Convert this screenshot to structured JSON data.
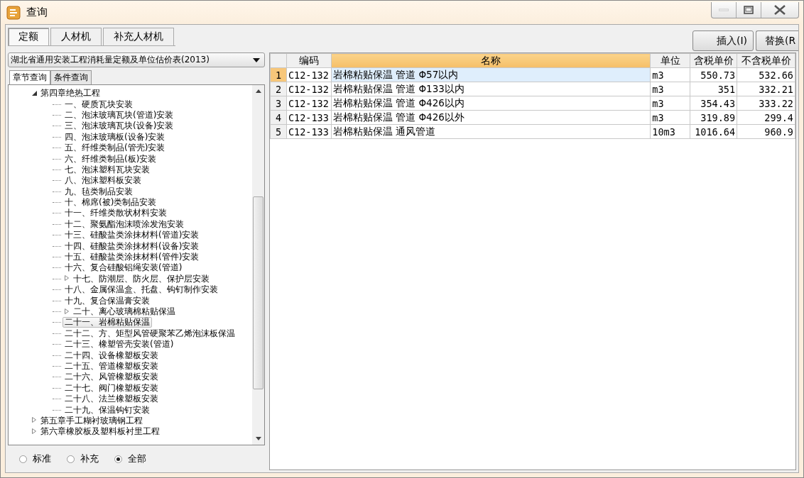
{
  "window": {
    "title": "查询"
  },
  "tabs": [
    {
      "label": "定额",
      "selected": true
    },
    {
      "label": "人材机",
      "selected": false
    },
    {
      "label": "补充人材机",
      "selected": false
    }
  ],
  "actions": [
    "插入(I)",
    "替换(R"
  ],
  "library": {
    "value": "湖北省通用安装工程消耗量定额及单位估价表(2013)"
  },
  "query_tabs": [
    {
      "label": "章节查询",
      "selected": true
    },
    {
      "label": "条件查询",
      "selected": false
    }
  ],
  "tree": [
    {
      "label": "第四章绝热工程",
      "kind": "folder",
      "expanded": true,
      "selected": false,
      "children": [
        {
          "label": "一、硬质瓦块安装",
          "kind": "leaf",
          "selected": false
        },
        {
          "label": "二、泡沫玻璃瓦块(管道)安装",
          "kind": "leaf",
          "selected": false
        },
        {
          "label": "三、泡沫玻璃瓦块(设备)安装",
          "kind": "leaf",
          "selected": false
        },
        {
          "label": "四、泡沫玻璃板(设备)安装",
          "kind": "leaf",
          "selected": false
        },
        {
          "label": "五、纤维类制品(管壳)安装",
          "kind": "leaf",
          "selected": false
        },
        {
          "label": "六、纤维类制品(板)安装",
          "kind": "leaf",
          "selected": false
        },
        {
          "label": "七、泡沫塑料瓦块安装",
          "kind": "leaf",
          "selected": false
        },
        {
          "label": "八、泡沫塑料板安装",
          "kind": "leaf",
          "selected": false
        },
        {
          "label": "九、毡类制品安装",
          "kind": "leaf",
          "selected": false
        },
        {
          "label": "十、棉席(被)类制品安装",
          "kind": "leaf",
          "selected": false
        },
        {
          "label": "十一、纤维类散状材料安装",
          "kind": "leaf",
          "selected": false
        },
        {
          "label": "十二、聚氨酯泡沫喷涂发泡安装",
          "kind": "leaf",
          "selected": false
        },
        {
          "label": "十三、硅酸盐类涂抹材料(管道)安装",
          "kind": "leaf",
          "selected": false
        },
        {
          "label": "十四、硅酸盐类涂抹材料(设备)安装",
          "kind": "leaf",
          "selected": false
        },
        {
          "label": "十五、硅酸盐类涂抹材料(管件)安装",
          "kind": "leaf",
          "selected": false
        },
        {
          "label": "十六、复合硅酸铝绳安装(管道)",
          "kind": "leaf",
          "selected": false
        },
        {
          "label": "十七、防潮层、防火层、保护层安装",
          "kind": "folder",
          "expanded": false,
          "selected": false
        },
        {
          "label": "十八、金属保温盒、托盘、钩钉制作安装",
          "kind": "leaf",
          "selected": false
        },
        {
          "label": "十九、复合保温膏安装",
          "kind": "leaf",
          "selected": false
        },
        {
          "label": "二十、离心玻璃棉粘贴保温",
          "kind": "folder",
          "expanded": false,
          "selected": false
        },
        {
          "label": "二十一、岩棉粘贴保温",
          "kind": "leaf",
          "selected": true
        },
        {
          "label": "二十二、方、矩型风管硬聚苯乙烯泡沫板保温",
          "kind": "leaf",
          "selected": false
        },
        {
          "label": "二十三、橡塑管壳安装(管道)",
          "kind": "leaf",
          "selected": false
        },
        {
          "label": "二十四、设备橡塑板安装",
          "kind": "leaf",
          "selected": false
        },
        {
          "label": "二十五、管道橡塑板安装",
          "kind": "leaf",
          "selected": false
        },
        {
          "label": "二十六、风管橡塑板安装",
          "kind": "leaf",
          "selected": false
        },
        {
          "label": "二十七、阀门橡塑板安装",
          "kind": "leaf",
          "selected": false
        },
        {
          "label": "二十八、法兰橡塑板安装",
          "kind": "leaf",
          "selected": false
        },
        {
          "label": "二十九、保温钩钉安装",
          "kind": "leaf",
          "selected": false
        }
      ]
    },
    {
      "label": "第五章手工糊衬玻璃钢工程",
      "kind": "folder",
      "expanded": false,
      "selected": false
    },
    {
      "label": "第六章橡胶板及塑料板衬里工程",
      "kind": "folder",
      "expanded": false,
      "selected": false
    }
  ],
  "filter": [
    {
      "label": "标准",
      "selected": false
    },
    {
      "label": "补充",
      "selected": false
    },
    {
      "label": "全部",
      "selected": true
    }
  ],
  "table": {
    "columns": [
      {
        "label": "编码",
        "selected": false
      },
      {
        "label": "名称",
        "selected": true
      },
      {
        "label": "单位",
        "selected": false
      },
      {
        "label": "含税单价",
        "selected": false
      },
      {
        "label": "不含税单价",
        "selected": false
      }
    ],
    "rows": [
      {
        "number": "1",
        "selected": true,
        "cells": [
          "C12-132",
          "岩棉粘贴保温 管道 Φ57以内",
          "m3",
          "550.73",
          "532.66"
        ]
      },
      {
        "number": "2",
        "selected": false,
        "cells": [
          "C12-132",
          "岩棉粘贴保温 管道 Φ133以内",
          "m3",
          "351",
          "332.21"
        ]
      },
      {
        "number": "3",
        "selected": false,
        "cells": [
          "C12-132",
          "岩棉粘贴保温 管道 Φ426以内",
          "m3",
          "354.43",
          "333.22"
        ]
      },
      {
        "number": "4",
        "selected": false,
        "cells": [
          "C12-133",
          "岩棉粘贴保温 管道 Φ426以外",
          "m3",
          "319.89",
          "299.4"
        ]
      },
      {
        "number": "5",
        "selected": false,
        "cells": [
          "C12-133",
          "岩棉粘贴保温 通风管道",
          "10m3",
          "1016.64",
          "960.9"
        ]
      }
    ]
  }
}
